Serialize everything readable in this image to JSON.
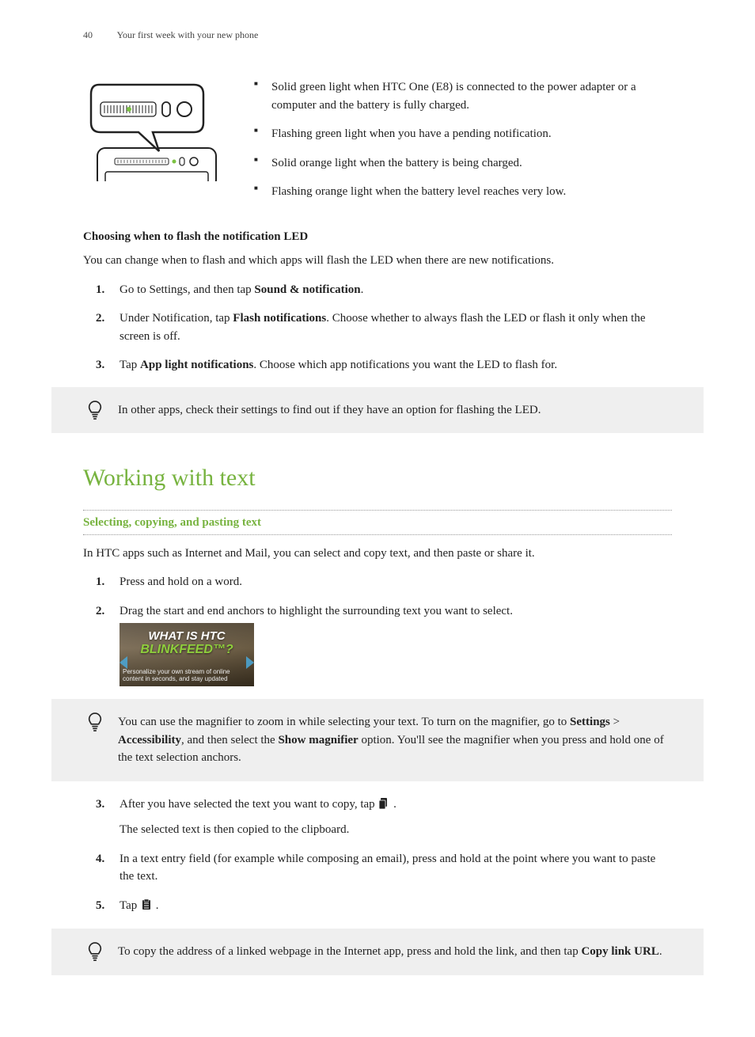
{
  "header": {
    "page_number": "40",
    "chapter": "Your first week with your new phone"
  },
  "led_bullets": [
    "Solid green light when HTC One (E8) is connected to the power adapter or a computer and the battery is fully charged.",
    "Flashing green light when you have a pending notification.",
    "Solid orange light when the battery is being charged.",
    "Flashing orange light when the battery level reaches very low."
  ],
  "led_subheading": "Choosing when to flash the notification LED",
  "led_intro": "You can change when to flash and which apps will flash the LED when there are new notifications.",
  "led_steps": {
    "s1a": "Go to Settings, and then tap ",
    "s1b": "Sound & notification",
    "s1c": ".",
    "s2a": "Under Notification, tap ",
    "s2b": "Flash notifications",
    "s2c": ". Choose whether to always flash the LED or flash it only when the screen is off.",
    "s3a": "Tap ",
    "s3b": "App light notifications",
    "s3c": ". Choose which app notifications you want the LED to flash for."
  },
  "tip1": "In other apps, check their settings to find out if they have an option for flashing the LED.",
  "section_title": "Working with text",
  "subsection_title": "Selecting, copying, and pasting text",
  "text_intro": "In HTC apps such as Internet and Mail, you can select and copy text, and then paste or share it.",
  "text_steps_1_2": {
    "s1": "Press and hold on a word.",
    "s2": "Drag the start and end anchors to highlight the surrounding text you want to select."
  },
  "banner": {
    "line1": "WHAT IS HTC",
    "line2": "BLINKFEED™?",
    "sub": "Personalize your own stream of online content in seconds, and stay updated"
  },
  "tip2": {
    "a": "You can use the magnifier to zoom in while selecting your text. To turn on the magnifier, go to ",
    "b": "Settings",
    "gt": " > ",
    "c": "Accessibility",
    "d": ", and then select the ",
    "e": "Show magnifier",
    "f": " option. You'll see the magnifier when you press and hold one of the text selection anchors."
  },
  "text_steps_3_5": {
    "s3a": "After you have selected the text you want to copy, tap ",
    "s3b": ".",
    "s3_sub": "The selected text is then copied to the clipboard.",
    "s4": "In a text entry field (for example while composing an email), press and hold at the point where you want to paste the text.",
    "s5a": "Tap ",
    "s5b": "."
  },
  "tip3": {
    "a": "To copy the address of a linked webpage in the Internet app, press and hold the link, and then tap ",
    "b": "Copy link URL",
    "c": "."
  }
}
